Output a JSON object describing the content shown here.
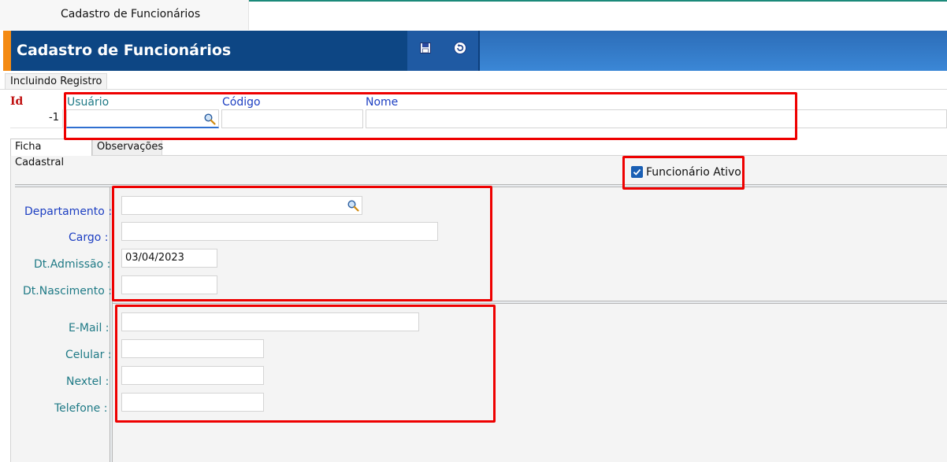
{
  "window": {
    "tab_title": "Cadastro de Funcionários"
  },
  "header": {
    "title": "Cadastro de Funcionários"
  },
  "toolbar": {
    "save_icon": "floppy-disk-icon",
    "back_icon": "undo-arrow-icon"
  },
  "mode_tab": "Incluindo Registro",
  "top_fields": {
    "id_label": "Id",
    "id_value": "-1",
    "usuario_label": "Usuário",
    "usuario_value": "",
    "codigo_label": "Código",
    "codigo_value": "",
    "nome_label": "Nome",
    "nome_value": ""
  },
  "tabs": [
    {
      "label": "Ficha Cadastral",
      "active": true
    },
    {
      "label": "Observações",
      "active": false
    }
  ],
  "ativo": {
    "label": "Funcionário Ativo",
    "checked": true
  },
  "ficha": {
    "departamento_label": "Departamento :",
    "departamento_value": "",
    "cargo_label": "Cargo :",
    "cargo_value": "",
    "admissao_label": "Dt.Admissão :",
    "admissao_value": "03/04/2023",
    "nascimento_label": "Dt.Nascimento :",
    "nascimento_value": ""
  },
  "contato": {
    "email_label": "E-Mail :",
    "email_value": "",
    "celular_label": "Celular :",
    "celular_value": "",
    "nextel_label": "Nextel :",
    "nextel_value": "",
    "telefone_label": "Telefone :",
    "telefone_value": ""
  },
  "colors": {
    "title_bg": "#0d4684",
    "toolbar_bg": "#2c6db8",
    "accent_orange": "#f48a12",
    "label_blue": "#1d3fc2",
    "label_teal": "#1f7a86",
    "required_red": "#c01010",
    "highlight_red": "#ee0000"
  }
}
